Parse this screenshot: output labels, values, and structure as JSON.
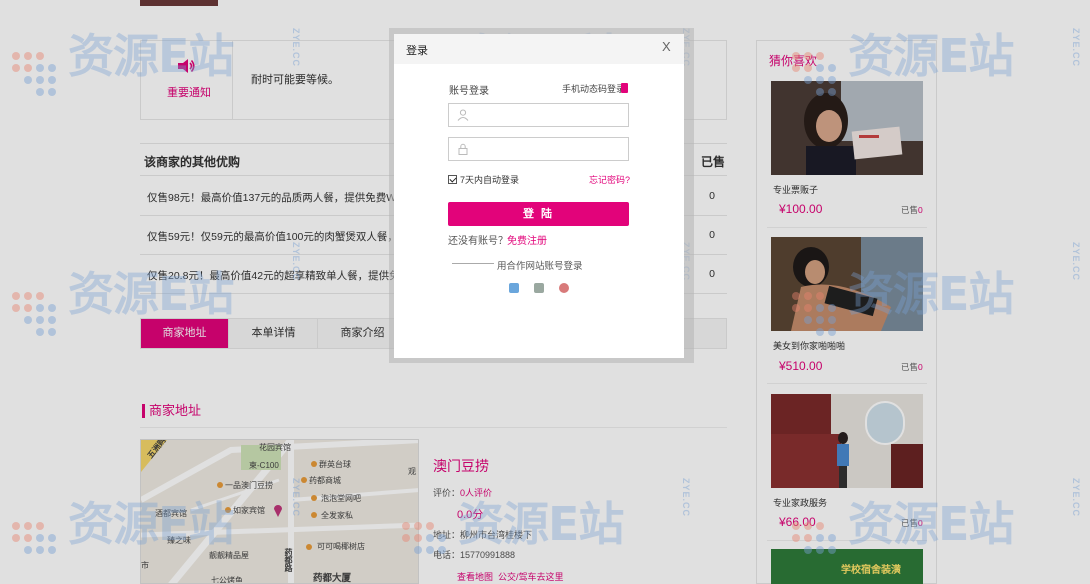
{
  "notice": {
    "label": "重要通知",
    "text": "耐时可能要等候。"
  },
  "offers": {
    "title": "该商家的其他优购",
    "sold_header": "已售",
    "rows": [
      {
        "text": "仅售98元！最高价值137元的品质两人餐，提供免费WiFi。",
        "count": "0"
      },
      {
        "text": "仅售59元！仅59元的最高价值100元的肉蟹煲双人餐，可免",
        "count": "0"
      },
      {
        "text": "仅售20.8元！最高价值42元的超享精致单人餐，提供免费W",
        "count": "0"
      }
    ]
  },
  "tabs": [
    "商家地址",
    "本单详情",
    "商家介绍"
  ],
  "address_section": {
    "title": "商家地址",
    "merchant_name": "澳门豆捞",
    "rating_label": "评价：",
    "rating_value": "0人评价",
    "score": "0.0分",
    "address": "地址：柳州市台湾桂楼下",
    "phone": "电话：15770991888",
    "view_map": "查看地图",
    "transit": "公交/驾车去这里"
  },
  "map_labels": {
    "l1": "花园宾馆",
    "l2": "柬-C100",
    "l3": "群英台球",
    "l4": "观",
    "l5": "一品澳门豆捞",
    "l6": "药都商城",
    "l7": "泡泡堂网吧",
    "l8": "全发家私",
    "l9": "如家宾馆",
    "l10": "酒都宾馆",
    "l11": "臻之味",
    "l12": "可可喝椰树店",
    "l13": "靓靓精品屋",
    "l14": "药都大厦",
    "l15": "七公烤鱼",
    "l16": "市",
    "l17": "药都路",
    "l18": "五洲购物中心"
  },
  "guess": {
    "title": "猜你喜欢",
    "sold_label": "已售",
    "items": [
      {
        "name": "专业票贩子",
        "price": "¥100.00",
        "sold": "0"
      },
      {
        "name": "美女到你家啪啪啪",
        "price": "¥510.00",
        "sold": "0"
      },
      {
        "name": "专业家政服务",
        "price": "¥66.00",
        "sold": "0"
      }
    ],
    "partial_item": "学校宿舍装潢"
  },
  "modal": {
    "title": "登录",
    "close": "X",
    "account_login": "账号登录",
    "phone_login": "手机动态码登录",
    "username_placeholder": "",
    "password_placeholder": "",
    "remember": "7天内自动登录",
    "forgot": "忘记密码?",
    "login_button": "登 陆",
    "no_account": "还没有账号？",
    "register": "免费注册",
    "partner_login": "用合作网站账号登录"
  },
  "watermark": {
    "text": "资源E站",
    "domain": "ZYE.CC"
  },
  "colors": {
    "accent": "#e2037a",
    "watermark": "#78a0d2"
  }
}
